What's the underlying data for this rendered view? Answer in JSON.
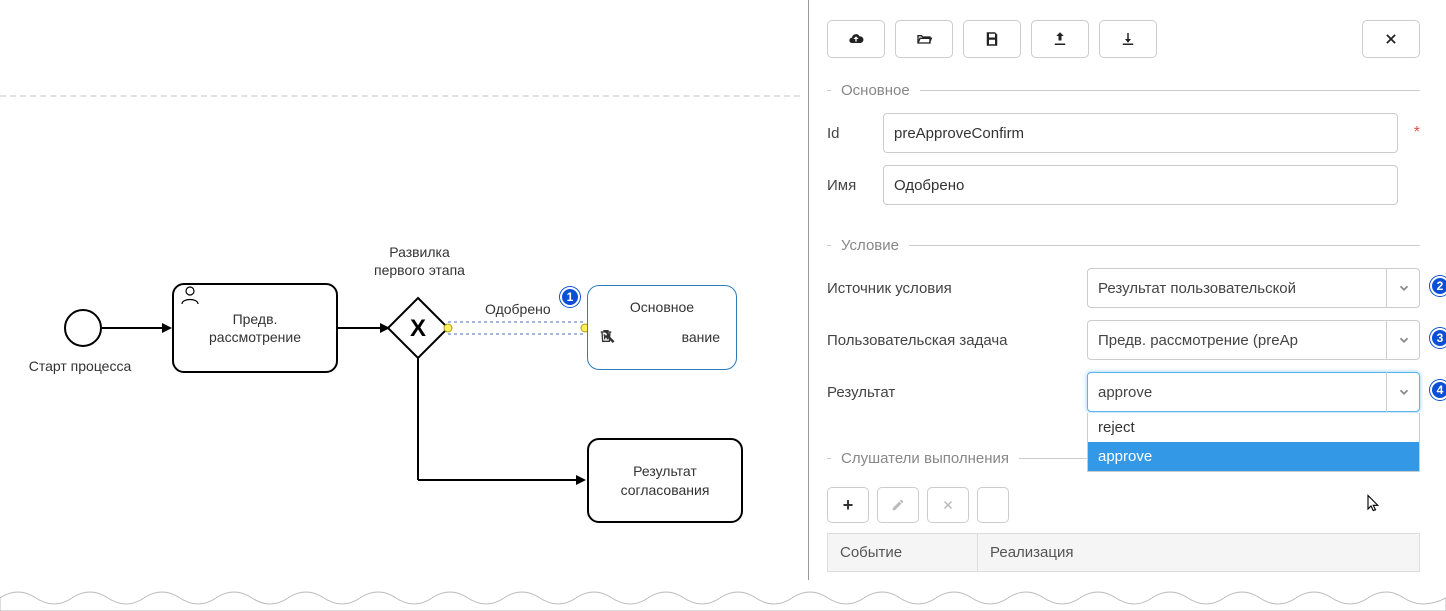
{
  "diagram": {
    "start_label": "Старт процесса",
    "gateway_label_l1": "Развилка",
    "gateway_label_l2": "первого этапа",
    "flow_label": "Одобрено",
    "task1_l1": "Предв.",
    "task1_l2": "рассмотрение",
    "task2_l1": "Основное",
    "task2_l2": "вание",
    "task3_l1": "Результат",
    "task3_l2": "согласования"
  },
  "markers": {
    "m1": "1",
    "m2": "2",
    "m3": "3",
    "m4": "4"
  },
  "sections": {
    "main_legend": "Основное",
    "condition_legend": "Условие",
    "listeners_legend": "Слушатели выполнения"
  },
  "fields": {
    "id_label": "Id",
    "id_value": "preApproveConfirm",
    "name_label": "Имя",
    "name_value": "Одобрено",
    "source_label": "Источник условия",
    "source_value": "Результат пользовательской",
    "usertask_label": "Пользовательская задача",
    "usertask_value": "Предв. рассмотрение (preAp",
    "result_label": "Результат",
    "result_value": "approve"
  },
  "dropdown": {
    "opt1": "reject",
    "opt2": "approve"
  },
  "table": {
    "col1": "Событие",
    "col2": "Реализация"
  }
}
